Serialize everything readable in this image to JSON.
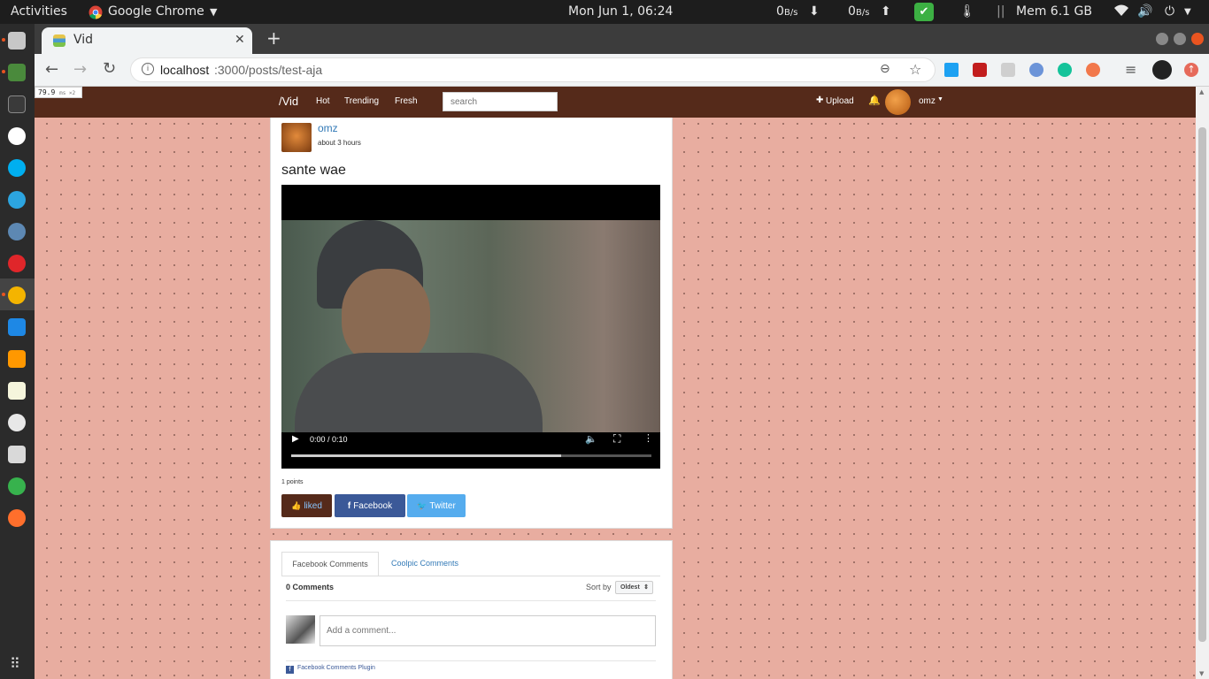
{
  "os_topbar": {
    "activities": "Activities",
    "app_name": "Google Chrome",
    "clock": "Mon Jun  1, 06:24",
    "net_down_value": "0",
    "net_down_unit": "B/s",
    "net_up_value": "0",
    "net_up_unit": "B/s",
    "memory": "Mem 6.1 GB"
  },
  "browser": {
    "tab_title": "Vid",
    "url_host": "localhost",
    "url_path": ":3000/posts/test-aja",
    "perf_overlay": "79.9",
    "perf_overlay_unit": "ms ×2"
  },
  "site_nav": {
    "brand": "/Vid",
    "links": [
      "Hot",
      "Trending",
      "Fresh"
    ],
    "search_placeholder": "search",
    "upload_label": "Upload",
    "username": "omz"
  },
  "post": {
    "author": "omz",
    "time_ago": "about 3 hours",
    "title": "sante wae",
    "video_time": "0:00 / 0:10",
    "video_progress": 0.75,
    "points": "1 points",
    "buttons": {
      "liked": "liked",
      "facebook": "Facebook",
      "twitter": "Twitter"
    }
  },
  "comments": {
    "tabs": [
      "Facebook Comments",
      "Coolpic Comments"
    ],
    "count": "0 Comments",
    "sort_label": "Sort by",
    "sort_value": "Oldest",
    "input_placeholder": "Add a comment...",
    "plugin_label": "Facebook Comments Plugin"
  },
  "colors": {
    "navbar": "#552a1a",
    "page_background": "#e8ada0",
    "liked_button": "#552a1a",
    "facebook_button": "#3b5998",
    "twitter_button": "#55acee",
    "link": "#337ab7"
  }
}
